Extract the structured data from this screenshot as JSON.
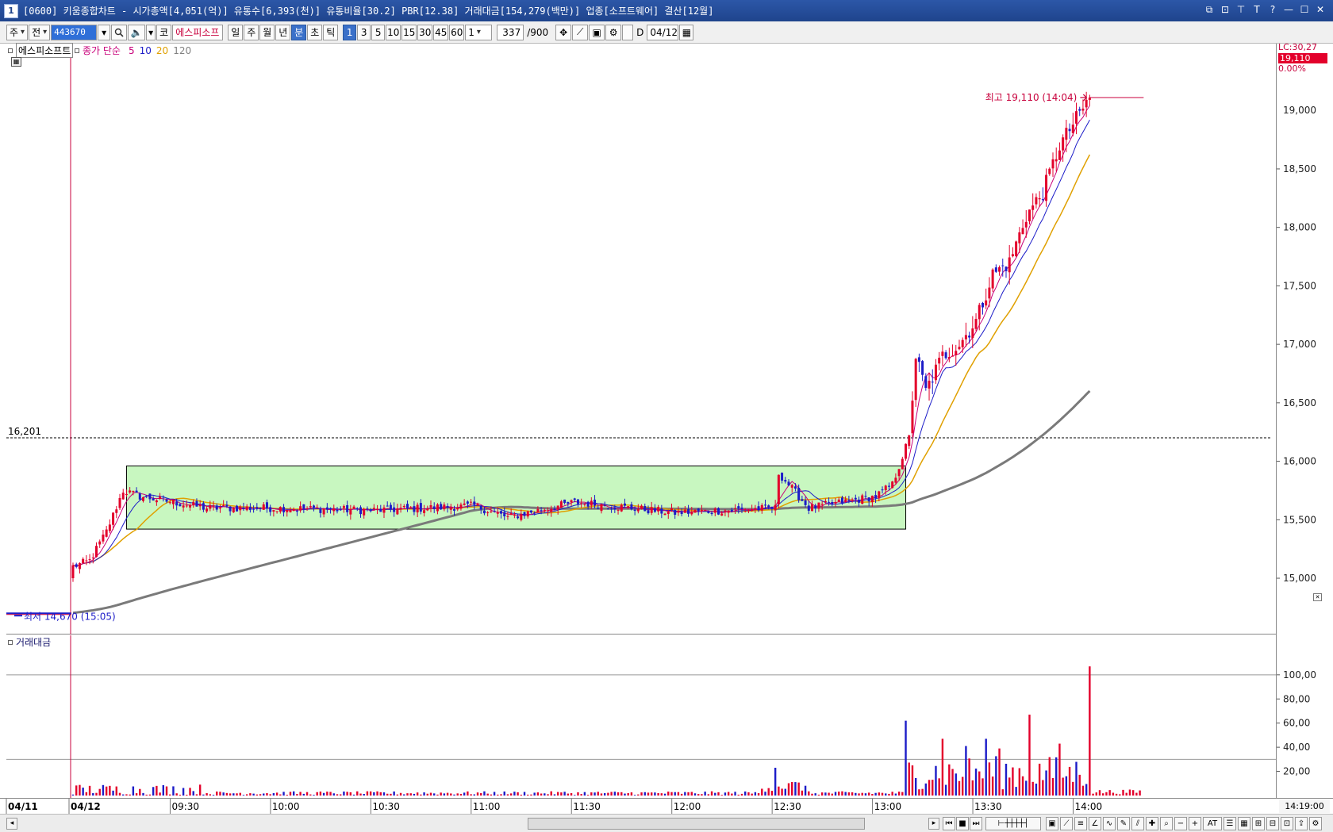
{
  "window": {
    "number": "1",
    "title": "[0600] 키움종합차트 - 시가총액[4,051(억)] 유통수[6,393(천)] 유통비율[30.2] PBR[12.38] 거래대금[154,279(백만)] 업종[소프트웨어] 결산[12월]",
    "buttons": [
      "⧉",
      "⊡",
      "⊤",
      "T",
      "?",
      "—",
      "☐",
      "✕"
    ]
  },
  "toolbar": {
    "type_label": "주",
    "market_label": "전",
    "code_value": "443670",
    "co_label": "코",
    "stock_name": "에스피소프",
    "periods": [
      "일",
      "주",
      "월",
      "년",
      "분",
      "초",
      "틱"
    ],
    "selected_period": "분",
    "intervals": [
      "1",
      "3",
      "5",
      "10",
      "15",
      "30",
      "45",
      "60"
    ],
    "selected_interval": "1",
    "count_select": "1",
    "bar_count": "337",
    "bar_total": "/900",
    "d_label": "D",
    "date_value": "04/12"
  },
  "main_pane": {
    "stock_tab": "에스피소프트",
    "indicator_name": "종가 단순",
    "ma_periods": [
      "5",
      "10",
      "20",
      "120"
    ],
    "ma_colors": [
      "#c8007a",
      "#1c1cc8",
      "#e0a000",
      "#808080"
    ],
    "high_label": "최고 19,110 (14:04)",
    "low_label": "최저 14,670 (15:05)",
    "ref_label": "16,201",
    "lc_label": "LC:30,27",
    "current_price": "19,110",
    "current_change": "0.00%",
    "y_ticks": [
      "18,500",
      "18,000",
      "17,500",
      "17,000",
      "16,500",
      "16,000",
      "15,500",
      "15,000"
    ],
    "partial_top_tick": "19,000"
  },
  "volume_pane": {
    "title": "거래대금",
    "y_ticks": [
      "100,00",
      "80,00",
      "60,00",
      "40,00",
      "20,00"
    ]
  },
  "time_axis": {
    "labels": [
      "04/11",
      "04/12",
      "09:30",
      "10:00",
      "10:30",
      "11:00",
      "11:30",
      "12:00",
      "12:30",
      "13:00",
      "13:30",
      "14:00"
    ],
    "cursor_time": "14:19:00"
  },
  "chart_data": {
    "type": "candlestick",
    "y_price_range": [
      14600,
      19300
    ],
    "reference_price": 16201,
    "high": {
      "price": 19110,
      "time": "14:04"
    },
    "low": {
      "price": 14670,
      "time": "15:05"
    },
    "moving_averages": [
      "5",
      "10",
      "20",
      "120"
    ],
    "consolidation_box": {
      "price_low": 15420,
      "price_high": 15960,
      "time_start": "09:16",
      "time_end": "13:09"
    },
    "price_path": [
      [
        "09:00",
        15100
      ],
      [
        "09:05",
        15150
      ],
      [
        "09:10",
        15400
      ],
      [
        "09:15",
        15750
      ],
      [
        "09:20",
        15700
      ],
      [
        "09:30",
        15650
      ],
      [
        "09:40",
        15600
      ],
      [
        "10:00",
        15600
      ],
      [
        "10:30",
        15580
      ],
      [
        "11:00",
        15620
      ],
      [
        "11:10",
        15520
      ],
      [
        "11:30",
        15650
      ],
      [
        "12:00",
        15560
      ],
      [
        "12:30",
        15600
      ],
      [
        "12:31",
        15900
      ],
      [
        "12:40",
        15600
      ],
      [
        "13:00",
        15700
      ],
      [
        "13:05",
        15800
      ],
      [
        "13:10",
        16200
      ],
      [
        "13:12",
        16900
      ],
      [
        "13:15",
        16600
      ],
      [
        "13:20",
        16900
      ],
      [
        "13:25",
        17000
      ],
      [
        "13:30",
        17200
      ],
      [
        "13:35",
        17600
      ],
      [
        "13:40",
        17700
      ],
      [
        "13:45",
        18100
      ],
      [
        "13:50",
        18300
      ],
      [
        "13:55",
        18700
      ],
      [
        "14:04",
        19110
      ]
    ],
    "volume_peaks": [
      [
        "12:30",
        23
      ],
      [
        "13:09",
        62
      ],
      [
        "13:20",
        47
      ],
      [
        "13:27",
        41
      ],
      [
        "13:33",
        47
      ],
      [
        "13:37",
        39
      ],
      [
        "13:46",
        67
      ],
      [
        "13:55",
        43
      ],
      [
        "14:04",
        107
      ]
    ]
  }
}
